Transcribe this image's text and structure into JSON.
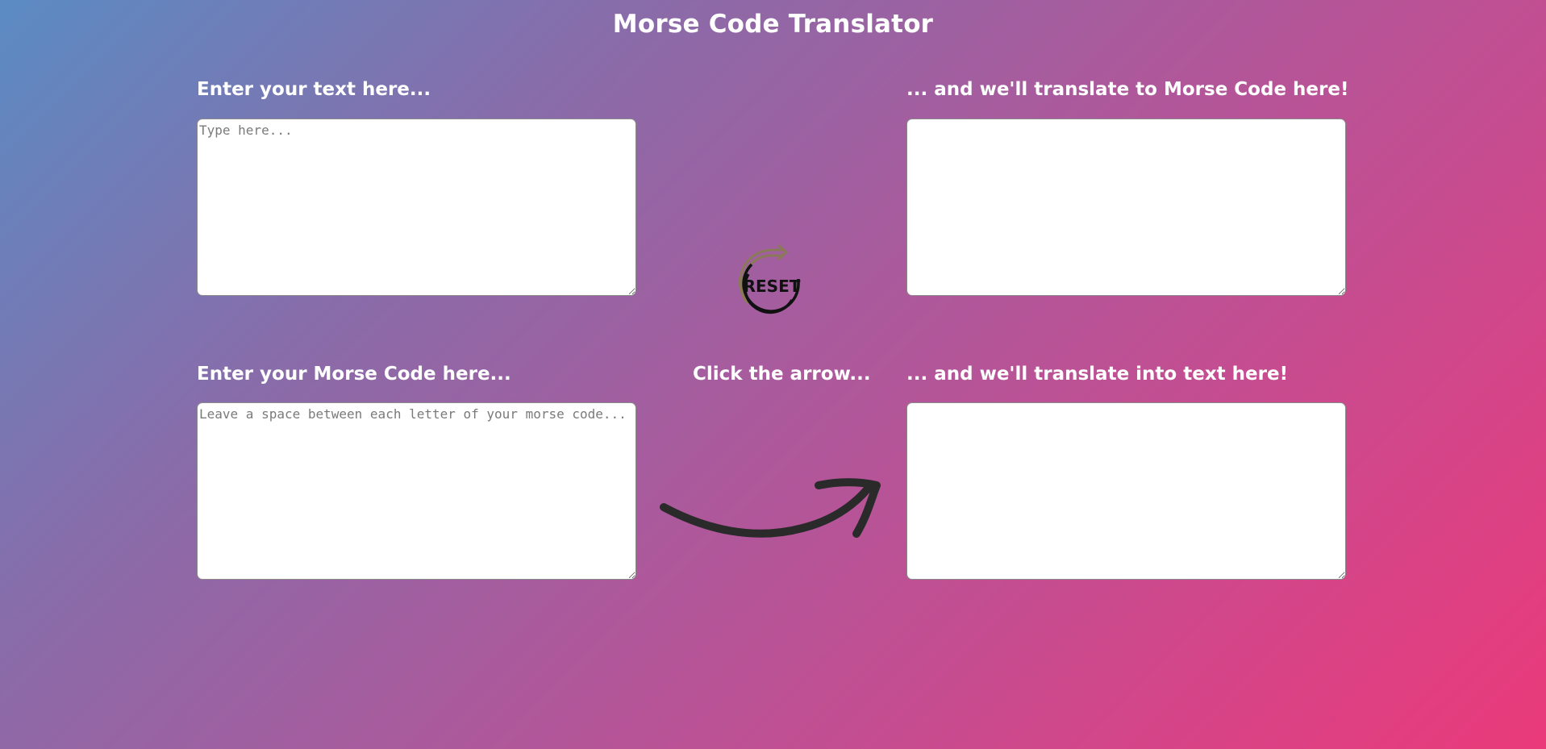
{
  "page": {
    "title": "Morse Code Translator"
  },
  "text_to_morse": {
    "input_label": "Enter your text here...",
    "input_placeholder": "Type here...",
    "input_value": "",
    "output_label": "... and we'll translate to Morse Code here!",
    "output_value": ""
  },
  "morse_to_text": {
    "input_label": "Enter your Morse Code here...",
    "input_placeholder": "Leave a space between each letter of your morse code...",
    "input_value": "",
    "arrow_hint": "Click the arrow...",
    "output_label": "... and we'll translate into text here!",
    "output_value": ""
  },
  "reset": {
    "label": "RESET",
    "icon": "reset-circular-arrow-icon"
  },
  "arrow": {
    "icon": "curved-arrow-right-icon"
  },
  "colors": {
    "gradient_start": "#5b8bc3",
    "gradient_end": "#ea3a7a",
    "text": "#ffffff",
    "reset_arrow": "#8a7a5a",
    "arrow": "#2a2a2a"
  }
}
